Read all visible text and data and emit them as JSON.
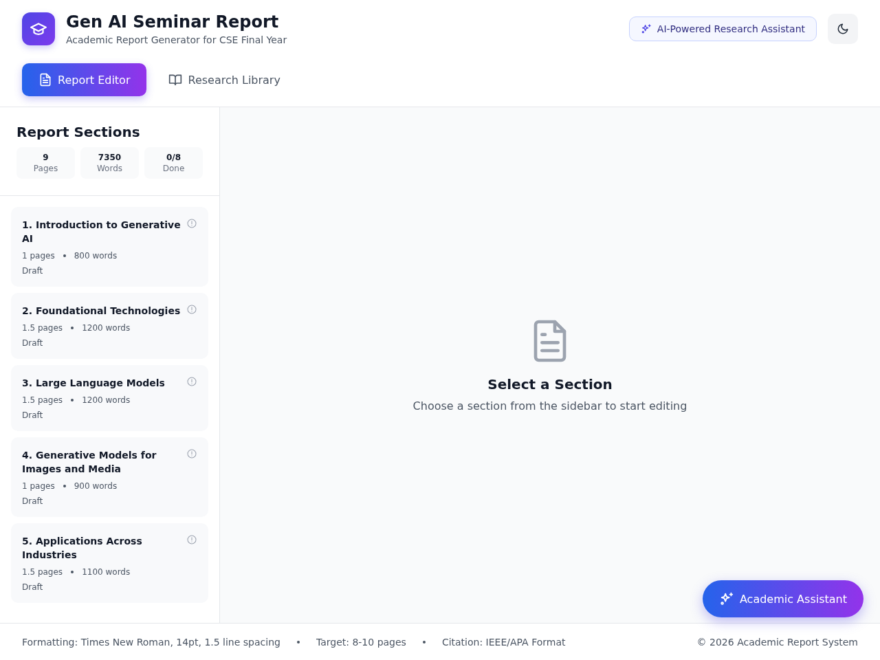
{
  "header": {
    "title": "Gen AI Seminar Report",
    "subtitle": "Academic Report Generator for CSE Final Year",
    "badge": "AI-Powered Research Assistant"
  },
  "tabs": [
    {
      "label": "Report Editor",
      "selected": true,
      "kind": "document"
    },
    {
      "label": "Research Library",
      "selected": false,
      "kind": "book"
    }
  ],
  "sidebar": {
    "title": "Report Sections",
    "stats": [
      {
        "value": "9",
        "label": "Pages"
      },
      {
        "value": "7350",
        "label": "Words"
      },
      {
        "value": "0/8",
        "label": "Done"
      }
    ],
    "sections": [
      {
        "title": "1. Introduction to Generative AI",
        "pages": "1 pages",
        "words": "800 words",
        "status": "Draft"
      },
      {
        "title": "2. Foundational Technologies",
        "pages": "1.5 pages",
        "words": "1200 words",
        "status": "Draft"
      },
      {
        "title": "3. Large Language Models",
        "pages": "1.5 pages",
        "words": "1200 words",
        "status": "Draft"
      },
      {
        "title": "4. Generative Models for Images and Media",
        "pages": "1 pages",
        "words": "900 words",
        "status": "Draft"
      },
      {
        "title": "5. Applications Across Industries",
        "pages": "1.5 pages",
        "words": "1100 words",
        "status": "Draft"
      }
    ]
  },
  "empty_state": {
    "title": "Select a Section",
    "message": "Choose a section from the sidebar to start editing"
  },
  "footer": {
    "items": [
      "Formatting: Times New Roman, 14pt, 1.5 line spacing",
      "Target: 8-10 pages",
      "Citation: IEEE/APA Format"
    ],
    "copyright": "© 2026 Academic Report System"
  },
  "assistant_button": {
    "label": "Academic Assistant"
  }
}
